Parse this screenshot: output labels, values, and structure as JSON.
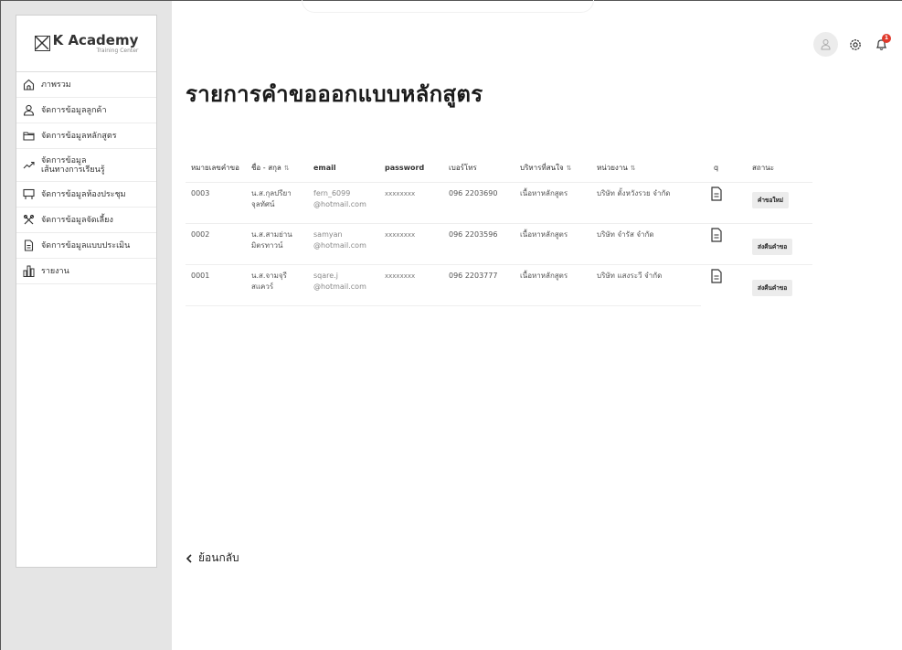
{
  "brand": {
    "title": "K Academy",
    "subtitle": "Training Center"
  },
  "sidebar": {
    "items": [
      {
        "label": "ภาพรวม",
        "icon": "home-icon"
      },
      {
        "label": "จัดการข้อมูลลูกค้า",
        "icon": "user-icon"
      },
      {
        "label": "จัดการข้อมูลหลักสูตร",
        "icon": "folder-icon"
      },
      {
        "label": "จัดการข้อมูล\nเส้นทางการเรียนรู้",
        "icon": "trend-icon"
      },
      {
        "label": "จัดการข้อมูลห้องประชุม",
        "icon": "screen-icon"
      },
      {
        "label": "จัดการข้อมูลจัดเลี้ยง",
        "icon": "utensils-icon"
      },
      {
        "label": "จัดการข้อมูลแบบประเมิน",
        "icon": "document-icon"
      },
      {
        "label": "รายงาน",
        "icon": "report-icon"
      }
    ]
  },
  "header": {
    "notification_count": "1"
  },
  "page": {
    "title": "รายการคำขอออกแบบหลักสูตร",
    "back_label": "ย้อนกลับ"
  },
  "table": {
    "headers": [
      "หมายเลขคำขอ",
      "ชื่อ - สกุล",
      "email",
      "password",
      "เบอร์โทร",
      "บริหารที่สนใจ",
      "หน่วยงาน",
      "q",
      "สถานะ"
    ],
    "rows": [
      {
        "id": "0003",
        "name": "น.ส.กุลปรียา\nจุลทัศน์",
        "email": "fern_6099\n@hotmail.com",
        "password": "xxxxxxxx",
        "phone": "096 2203690",
        "interest": "เนื้อหาหลักสูตร",
        "org": "บริษัท ตั้งหวังรวย จำกัด",
        "status": "คำขอใหม่"
      },
      {
        "id": "0002",
        "name": "น.ส.สามย่าน\nมิตรทาวน์",
        "email": "samyan\n@hotmail.com",
        "password": "xxxxxxxx",
        "phone": "096 2203596",
        "interest": "เนื้อหาหลักสูตร",
        "org": "บริษัท จำรัส จำกัด",
        "status": "ส่งคืนคำขอ"
      },
      {
        "id": "0001",
        "name": "น.ส.จามจุรี\nสแควร์",
        "email": "sqare.j\n@hotmail.com",
        "password": "xxxxxxxx",
        "phone": "096 2203777",
        "interest": "เนื้อหาหลักสูตร",
        "org": "บริษัท แสงระวี จำกัด",
        "status": "ส่งคืนคำขอ"
      }
    ]
  }
}
